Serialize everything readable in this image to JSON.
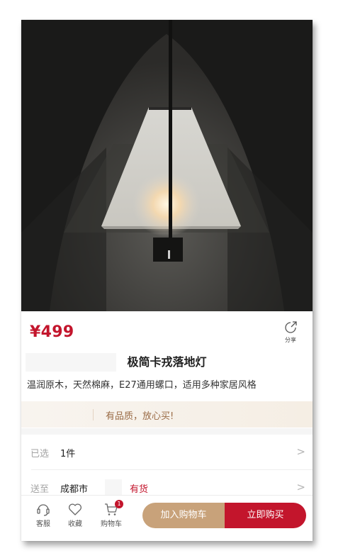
{
  "product": {
    "price": "¥499",
    "title": "极简卡戎落地灯",
    "subtitle": "温润原木，天然棉麻，E27通用螺口，适用多种家居风格",
    "slogan": "有品质，放心买!"
  },
  "share": {
    "label": "分享",
    "icon": "share-icon"
  },
  "options": {
    "selected": {
      "label": "已选",
      "value": "1件"
    },
    "delivery": {
      "label": "送至",
      "city": "成都市",
      "stock": "有货"
    }
  },
  "bottom_bar": {
    "service": {
      "label": "客服",
      "icon": "headset-icon"
    },
    "favorite": {
      "label": "收藏",
      "icon": "heart-icon"
    },
    "cart": {
      "label": "购物车",
      "icon": "cart-icon",
      "badge": "1"
    },
    "add_to_cart": "加入购物车",
    "buy_now": "立即购买"
  },
  "colors": {
    "price_red": "#c3152c",
    "buy_red": "#c3152c",
    "cart_gold": "#c8a27a",
    "slogan_brown": "#9a6b45"
  }
}
